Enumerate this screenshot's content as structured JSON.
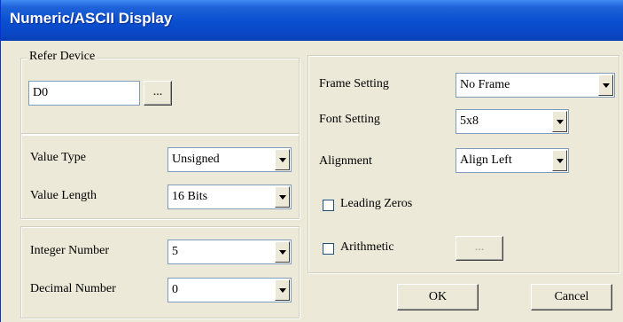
{
  "window": {
    "title": "Numeric/ASCII Display"
  },
  "refer_device": {
    "legend": "Refer Device",
    "value": "D0",
    "browse_label": "..."
  },
  "value_group": {
    "value_type_label": "Value Type",
    "value_type": "Unsigned",
    "value_length_label": "Value Length",
    "value_length": "16 Bits"
  },
  "number_group": {
    "integer_label": "Integer Number",
    "integer_value": "5",
    "decimal_label": "Decimal Number",
    "decimal_value": "0"
  },
  "format_group": {
    "frame_label": "Frame Setting",
    "frame_value": "No Frame",
    "font_label": "Font Setting",
    "font_value": "5x8",
    "alignment_label": "Alignment",
    "alignment_value": "Align Left",
    "leading_zeros_label": "Leading Zeros",
    "leading_zeros_checked": false,
    "arithmetic_label": "Arithmetic",
    "arithmetic_checked": false,
    "arithmetic_button_label": "..."
  },
  "buttons": {
    "ok": "OK",
    "cancel": "Cancel"
  },
  "colors": {
    "titlebar": "#0a50d0",
    "face": "#ece9d8",
    "field_border": "#7f9db9"
  }
}
